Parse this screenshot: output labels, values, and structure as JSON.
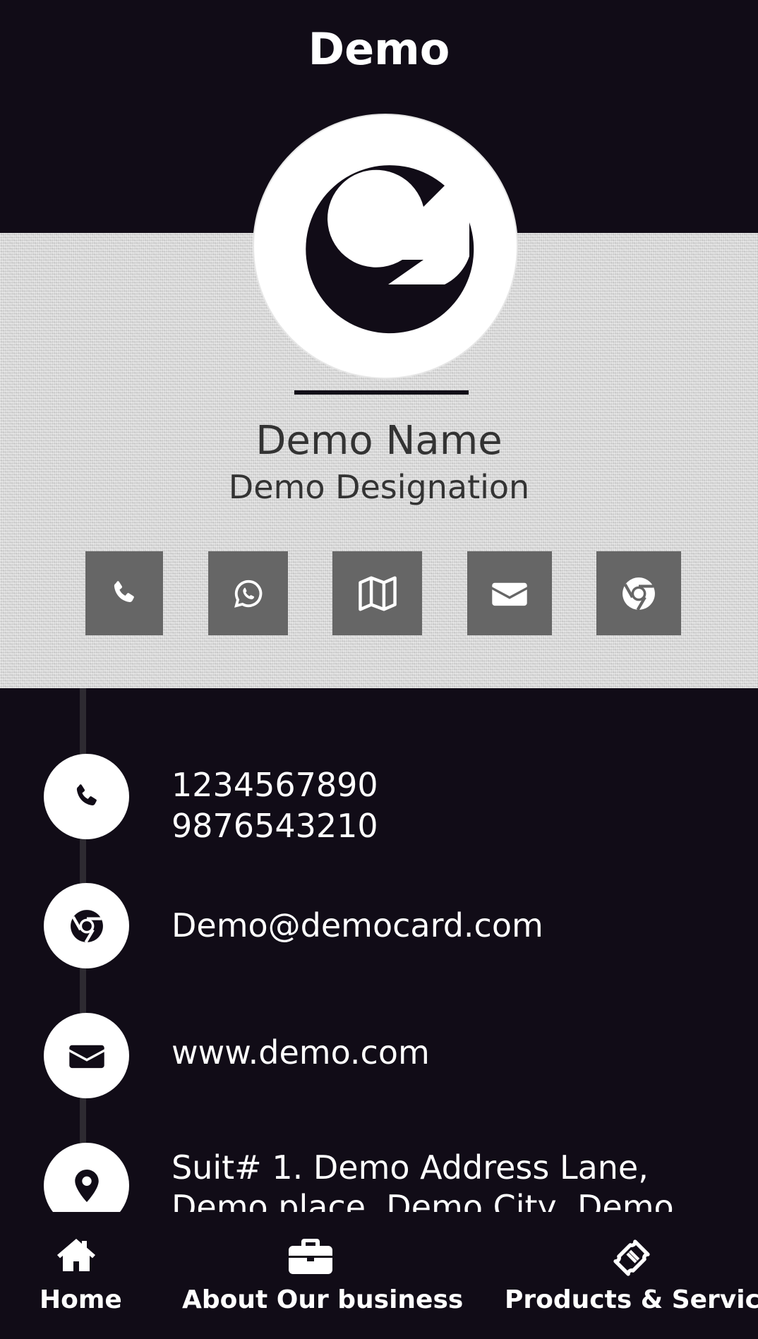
{
  "header": {
    "title": "Demo"
  },
  "profile": {
    "logo_letter": "G",
    "name": "Demo Name",
    "designation": "Demo Designation"
  },
  "actions": [
    {
      "icon": "phone-icon"
    },
    {
      "icon": "whatsapp-icon"
    },
    {
      "icon": "map-icon"
    },
    {
      "icon": "envelope-icon"
    },
    {
      "icon": "chrome-icon"
    }
  ],
  "contacts": {
    "phone_1": "1234567890",
    "phone_2": "9876543210",
    "email": "Demo@democard.com",
    "website": "www.demo.com",
    "address_line_1": "Suit# 1. Demo Address Lane,",
    "address_line_2": "Demo place, Demo City, Demo"
  },
  "bottom_nav": {
    "home_label": "Home",
    "about_label": "About Our business",
    "products_label": "Products & Services"
  },
  "colors": {
    "background": "#110c17",
    "fabric": "#d9d9d9",
    "action_button": "#666666",
    "text_dark": "#333333",
    "text_light": "#ffffff"
  }
}
